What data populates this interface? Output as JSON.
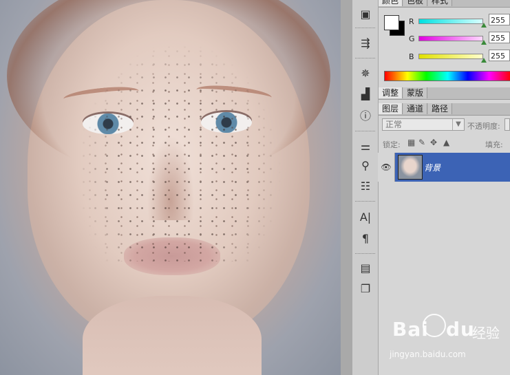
{
  "colors": {
    "panel_bg": "#d6d6d6",
    "selected_layer": "#3c63b5",
    "r_slider": "#00e0e0",
    "g_slider": "#e000e0",
    "b_slider": "#e0e000"
  },
  "tools": {
    "icons": [
      "mini-bridge-icon",
      "history-icon",
      "navigator-icon",
      "histogram-icon",
      "info-icon",
      "brush-presets-icon",
      "clone-source-icon",
      "tool-presets-icon",
      "character-icon",
      "paragraph-icon",
      "notes-icon",
      "layer-comps-icon"
    ]
  },
  "color_panel": {
    "tabs": [
      "颜色",
      "色板",
      "样式"
    ],
    "r_label": "R",
    "g_label": "G",
    "b_label": "B",
    "r_value": "255",
    "g_value": "255",
    "b_value": "255"
  },
  "adjust_panel": {
    "tabs": [
      "调整",
      "蒙版"
    ]
  },
  "layers_panel": {
    "tabs": [
      "图层",
      "通道",
      "路径"
    ],
    "blend_mode": "正常",
    "opacity_label": "不透明度:",
    "lock_label": "锁定:",
    "fill_label": "填充:",
    "layer_name": "背景"
  },
  "watermark": {
    "brand": "Bai",
    "brand2": "du",
    "product": "经验",
    "url": "jingyan.baidu.com"
  }
}
